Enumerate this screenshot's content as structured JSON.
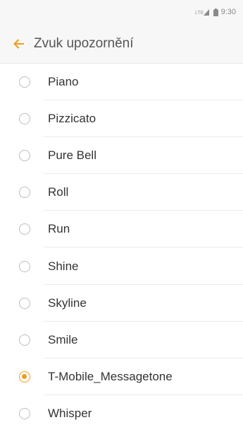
{
  "status_bar": {
    "time": "9:30",
    "network_icon": "signal-icon",
    "battery_icon": "battery-icon"
  },
  "app_bar": {
    "title": "Zvuk upozornění",
    "back_icon": "back-arrow-icon"
  },
  "colors": {
    "accent": "#f39a1e",
    "background": "#ffffff",
    "bar": "#f7f7f7"
  },
  "options": [
    {
      "label": "Piano",
      "selected": false
    },
    {
      "label": "Pizzicato",
      "selected": false
    },
    {
      "label": "Pure Bell",
      "selected": false
    },
    {
      "label": "Roll",
      "selected": false
    },
    {
      "label": "Run",
      "selected": false
    },
    {
      "label": "Shine",
      "selected": false
    },
    {
      "label": "Skyline",
      "selected": false
    },
    {
      "label": "Smile",
      "selected": false
    },
    {
      "label": "T-Mobile_Messagetone",
      "selected": true
    },
    {
      "label": "Whisper",
      "selected": false
    }
  ]
}
